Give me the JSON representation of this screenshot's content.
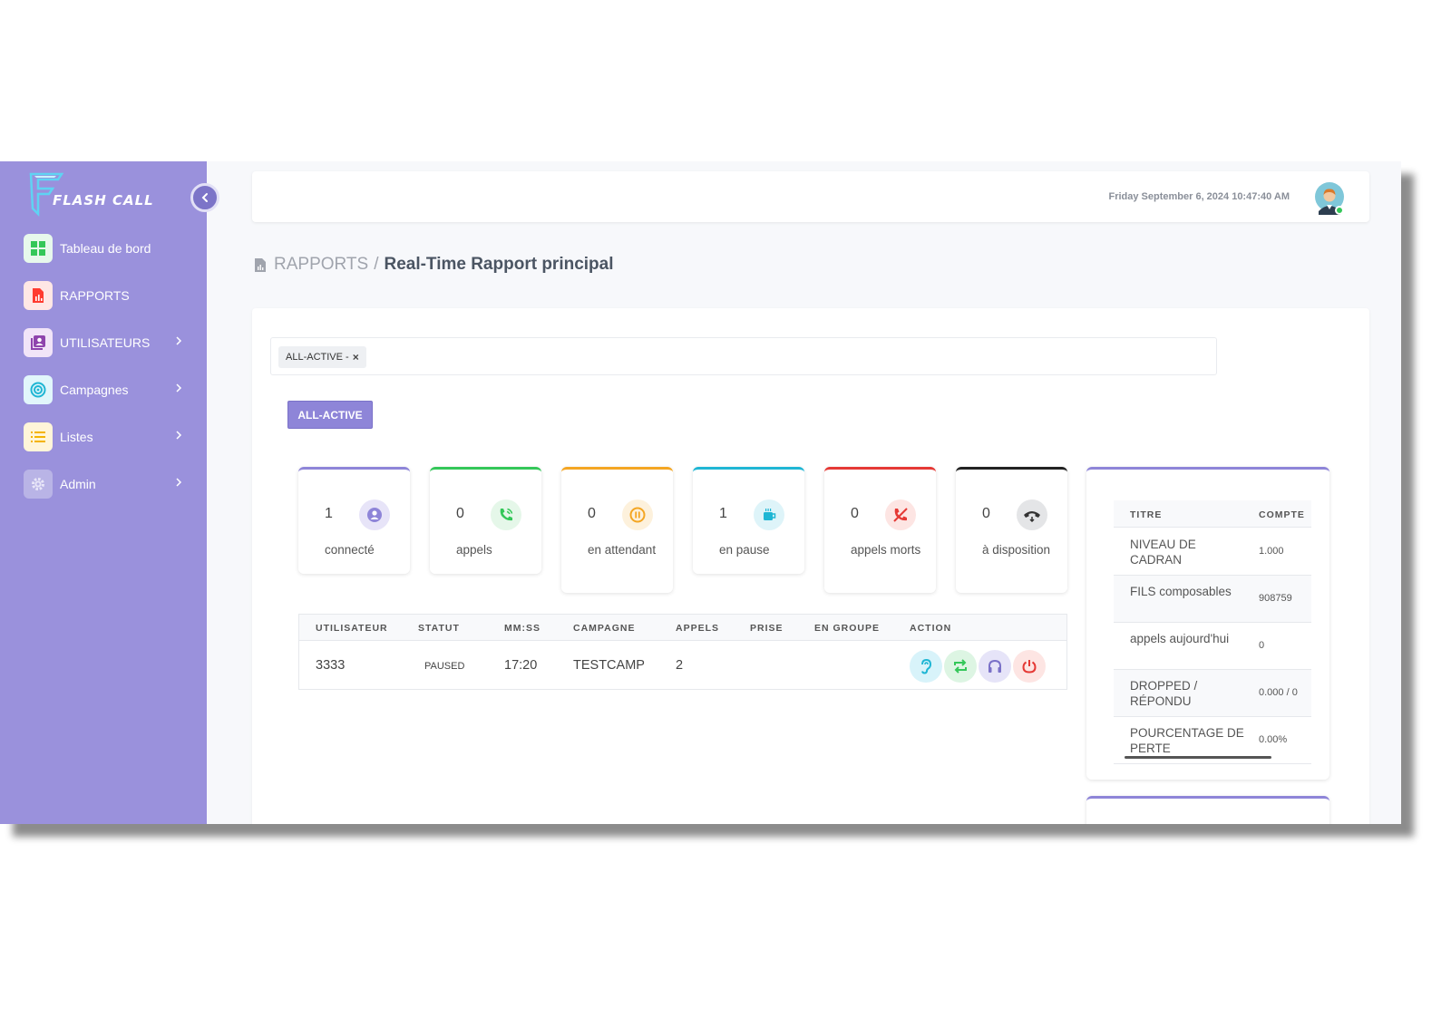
{
  "app": {
    "name": "FLASH CALL"
  },
  "sidebar": {
    "items": [
      {
        "label": "Tableau de bord",
        "icon": "dashboard-icon",
        "color": "#34c759"
      },
      {
        "label": "RAPPORTS",
        "icon": "report-icon",
        "color": "#ff3b30"
      },
      {
        "label": "UTILISATEURS",
        "icon": "users-icon",
        "color": "#8e44ad"
      },
      {
        "label": "Campagnes",
        "icon": "target-icon",
        "color": "#1fb6d4"
      },
      {
        "label": "Listes",
        "icon": "list-icon",
        "color": "#f4b400"
      },
      {
        "label": "Admin",
        "icon": "gear-icon",
        "color": "#a8a4d8"
      }
    ]
  },
  "header": {
    "datetime": "Friday September 6, 2024 10:47:40 AM"
  },
  "breadcrumb": {
    "root": "RAPPORTS",
    "separator": "/",
    "current": "Real-Time Rapport principal"
  },
  "filter": {
    "chip_label": "ALL-ACTIVE -",
    "chip_remove": "×"
  },
  "campaign_button": {
    "label": "ALL-ACTIVE"
  },
  "stats": [
    {
      "value": "1",
      "label": "connecté",
      "color": "#8e85d8",
      "icon": "user-icon"
    },
    {
      "value": "0",
      "label": "appels",
      "color": "#34c759",
      "icon": "phone-call-icon"
    },
    {
      "value": "0",
      "label": "en attendant",
      "color": "#f4a623",
      "icon": "pause-icon"
    },
    {
      "value": "1",
      "label": "en pause",
      "color": "#1fb6d4",
      "icon": "coffee-icon"
    },
    {
      "value": "0",
      "label": "appels morts",
      "color": "#e53935",
      "icon": "phone-off-icon"
    },
    {
      "value": "0",
      "label": "à disposition",
      "color": "#222222",
      "icon": "hangup-icon"
    }
  ],
  "agents_table": {
    "headers": [
      "UTILISATEUR",
      "STATUT",
      "MM:SS",
      "CAMPAGNE",
      "APPELS",
      "PRISE",
      "EN GROUPE",
      "ACTION"
    ],
    "rows": [
      {
        "utilisateur": "3333",
        "statut": "PAUSED",
        "mmss": "17:20",
        "campagne": "TESTCAMP",
        "appels": "2",
        "prise": "",
        "en_groupe": ""
      }
    ],
    "actions": [
      "listen-icon",
      "transfer-icon",
      "headset-icon",
      "power-icon"
    ]
  },
  "summary": {
    "headers": [
      "TITRE",
      "COMPTE"
    ],
    "rows": [
      {
        "titre": "NIVEAU DE CADRAN",
        "compte": "1.000"
      },
      {
        "titre": "FILS composables",
        "compte": "908759"
      },
      {
        "titre": "appels aujourd'hui",
        "compte": "0"
      },
      {
        "titre": "DROPPED / RÉPONDU",
        "compte": "0.000 / 0"
      },
      {
        "titre": "POURCENTAGE DE PERTE",
        "compte": "0.00%"
      }
    ]
  }
}
